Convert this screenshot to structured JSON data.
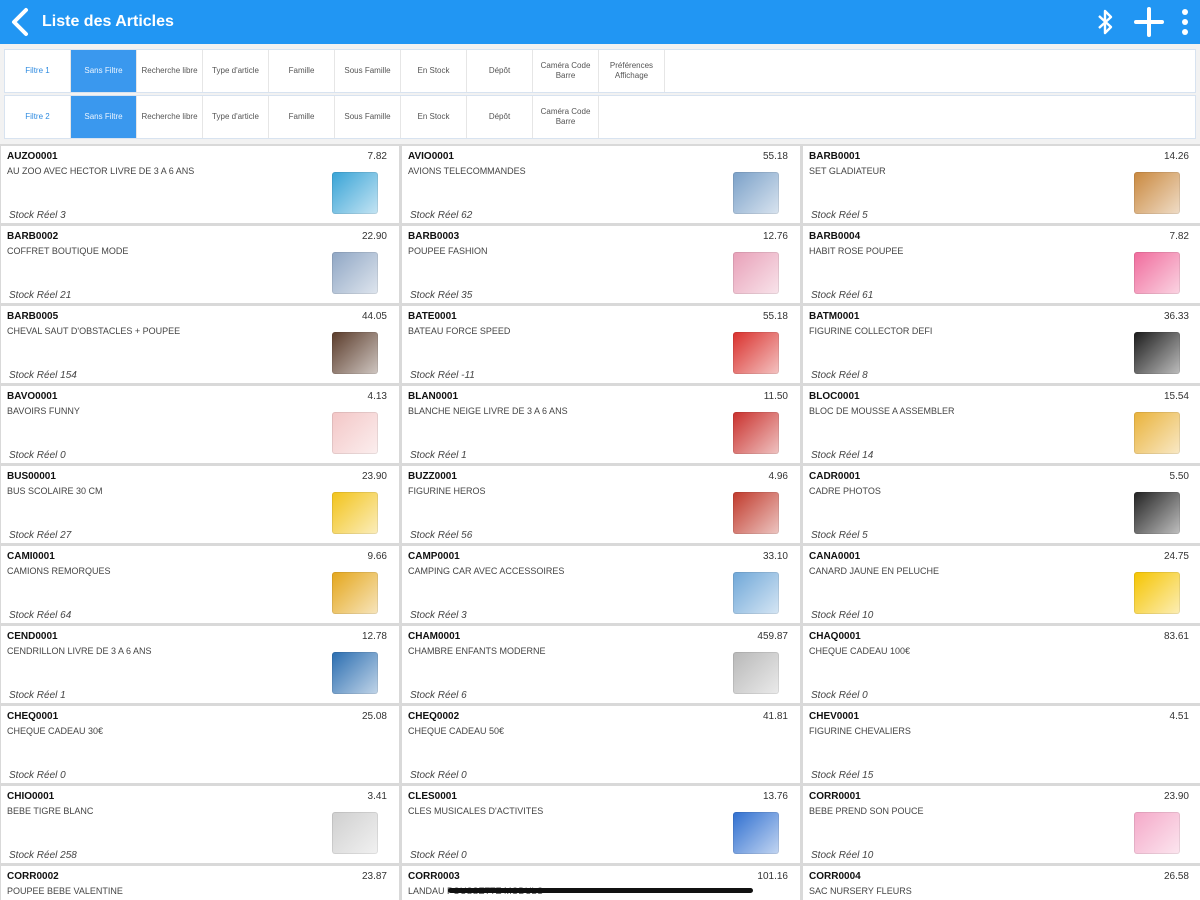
{
  "header": {
    "title": "Liste des Articles"
  },
  "filters": [
    {
      "label": "Filtre 1",
      "cells": [
        "Sans Filtre",
        "Recherche libre",
        "Type d'article",
        "Famille",
        "Sous Famille",
        "En Stock",
        "Dépôt",
        "Caméra Code Barre",
        "Préférences Affichage"
      ]
    },
    {
      "label": "Filtre 2",
      "cells": [
        "Sans Filtre",
        "Recherche libre",
        "Type d'article",
        "Famille",
        "Sous Famille",
        "En Stock",
        "Dépôt",
        "Caméra Code Barre"
      ]
    }
  ],
  "articles": [
    {
      "code": "AUZO0001",
      "price": "7.82",
      "desc": "AU ZOO AVEC HECTOR LIVRE DE 3 A 6 ANS",
      "stock": "Stock Réel 3",
      "img": "book-icon",
      "color": "#37a3d6"
    },
    {
      "code": "AVIO0001",
      "price": "55.18",
      "desc": "AVIONS TELECOMMANDES",
      "stock": "Stock Réel 62",
      "img": "plane-icon",
      "color": "#7aa0c8"
    },
    {
      "code": "BARB0001",
      "price": "14.26",
      "desc": "SET GLADIATEUR",
      "stock": "Stock Réel 5",
      "img": "figures-icon",
      "color": "#c9883e"
    },
    {
      "code": "BARB0002",
      "price": "22.90",
      "desc": "COFFRET BOUTIQUE MODE",
      "stock": "Stock Réel 21",
      "img": "box-icon",
      "color": "#8fa6c4"
    },
    {
      "code": "BARB0003",
      "price": "12.76",
      "desc": "POUPEE FASHION",
      "stock": "Stock Réel 35",
      "img": "doll-icon",
      "color": "#e8a0b8"
    },
    {
      "code": "BARB0004",
      "price": "7.82",
      "desc": "HABIT ROSE POUPEE",
      "stock": "Stock Réel 61",
      "img": "dress-icon",
      "color": "#f06b9c"
    },
    {
      "code": "BARB0005",
      "price": "44.05",
      "desc": "CHEVAL SAUT D'OBSTACLES + POUPEE",
      "stock": "Stock Réel 154",
      "img": "horse-icon",
      "color": "#5a3b2a"
    },
    {
      "code": "BATE0001",
      "price": "55.18",
      "desc": "BATEAU FORCE SPEED",
      "stock": "Stock Réel -11",
      "img": "boat-icon",
      "color": "#d9302c"
    },
    {
      "code": "BATM0001",
      "price": "36.33",
      "desc": "FIGURINE COLLECTOR DEFI",
      "stock": "Stock Réel 8",
      "img": "figurine-icon",
      "color": "#1b1b1b"
    },
    {
      "code": "BAVO0001",
      "price": "4.13",
      "desc": "BAVOIRS FUNNY",
      "stock": "Stock Réel 0",
      "img": "bib-icon",
      "color": "#f3c6c6"
    },
    {
      "code": "BLAN0001",
      "price": "11.50",
      "desc": "BLANCHE NEIGE LIVRE DE 3 A 6 ANS",
      "stock": "Stock Réel 1",
      "img": "book-icon",
      "color": "#c9302c"
    },
    {
      "code": "BLOC0001",
      "price": "15.54",
      "desc": "BLOC DE MOUSSE A ASSEMBLER",
      "stock": "Stock Réel 14",
      "img": "blocks-icon",
      "color": "#e9b23a"
    },
    {
      "code": "BUS00001",
      "price": "23.90",
      "desc": "BUS SCOLAIRE 30 CM",
      "stock": "Stock Réel 27",
      "img": "bus-icon",
      "color": "#f2c31a"
    },
    {
      "code": "BUZZ0001",
      "price": "4.96",
      "desc": "FIGURINE HEROS",
      "stock": "Stock Réel 56",
      "img": "heroes-icon",
      "color": "#c0392b"
    },
    {
      "code": "CADR0001",
      "price": "5.50",
      "desc": "CADRE PHOTOS",
      "stock": "Stock Réel 5",
      "img": "frame-icon",
      "color": "#222222"
    },
    {
      "code": "CAMI0001",
      "price": "9.66",
      "desc": "CAMIONS REMORQUES",
      "stock": "Stock Réel 64",
      "img": "truck-icon",
      "color": "#e4a61b"
    },
    {
      "code": "CAMP0001",
      "price": "33.10",
      "desc": "CAMPING CAR AVEC ACCESSOIRES",
      "stock": "Stock Réel 3",
      "img": "camper-icon",
      "color": "#6fa7d8"
    },
    {
      "code": "CANA0001",
      "price": "24.75",
      "desc": "CANARD JAUNE EN PELUCHE",
      "stock": "Stock Réel 10",
      "img": "duck-icon",
      "color": "#f5c400"
    },
    {
      "code": "CEND0001",
      "price": "12.78",
      "desc": "CENDRILLON LIVRE DE 3 A 6 ANS",
      "stock": "Stock Réel 1",
      "img": "book-icon",
      "color": "#2a6db0"
    },
    {
      "code": "CHAM0001",
      "price": "459.87",
      "desc": "CHAMBRE ENFANTS MODERNE",
      "stock": "Stock Réel 6",
      "img": "bed-icon",
      "color": "#b8b8b8"
    },
    {
      "code": "CHAQ0001",
      "price": "83.61",
      "desc": "CHEQUE CADEAU 100€",
      "stock": "Stock Réel 0",
      "img": "",
      "color": ""
    },
    {
      "code": "CHEQ0001",
      "price": "25.08",
      "desc": "CHEQUE CADEAU 30€",
      "stock": "Stock Réel 0",
      "img": "",
      "color": ""
    },
    {
      "code": "CHEQ0002",
      "price": "41.81",
      "desc": "CHEQUE CADEAU 50€",
      "stock": "Stock Réel 0",
      "img": "",
      "color": ""
    },
    {
      "code": "CHEV0001",
      "price": "4.51",
      "desc": "FIGURINE CHEVALIERS",
      "stock": "Stock Réel 15",
      "img": "",
      "color": ""
    },
    {
      "code": "CHIO0001",
      "price": "3.41",
      "desc": "BEBE TIGRE BLANC",
      "stock": "Stock Réel 258",
      "img": "tiger-icon",
      "color": "#cfcfcf"
    },
    {
      "code": "CLES0001",
      "price": "13.76",
      "desc": "CLES MUSICALES D'ACTIVITES",
      "stock": "Stock Réel 0",
      "img": "keys-icon",
      "color": "#2f6fd0"
    },
    {
      "code": "CORR0001",
      "price": "23.90",
      "desc": "BEBE PREND SON POUCE",
      "stock": "Stock Réel 10",
      "img": "baby-icon",
      "color": "#f4a8c8"
    },
    {
      "code": "CORR0002",
      "price": "23.87",
      "desc": "POUPEE BEBE VALENTINE",
      "stock": "",
      "img": "",
      "color": ""
    },
    {
      "code": "CORR0003",
      "price": "101.16",
      "desc": "LANDAU POUSSETTE MODULO",
      "stock": "",
      "img": "",
      "color": ""
    },
    {
      "code": "CORR0004",
      "price": "26.58",
      "desc": "SAC NURSERY FLEURS",
      "stock": "",
      "img": "",
      "color": ""
    }
  ]
}
